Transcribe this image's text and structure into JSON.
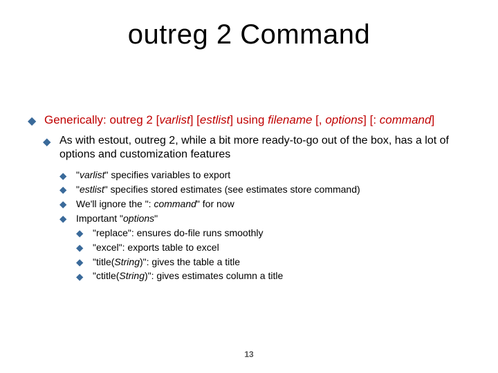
{
  "title": "outreg 2 Command",
  "generic": {
    "prefix": "Generically: outreg 2 [",
    "varlist": "varlist",
    "mid1": "] [",
    "estlist": "estlist",
    "mid2": "] using ",
    "filename": "filename",
    "mid3": " [, ",
    "options": "options",
    "mid4": "] [: ",
    "command": "command",
    "end": "]"
  },
  "lvl2_text": "As with estout, outreg 2, while a bit more ready-to-go out of the box, has a lot of options and customization features",
  "l3a": {
    "q1": "\"",
    "v": "varlist",
    "rest": "\" specifies variables to export"
  },
  "l3b": {
    "q1": "\"",
    "v": "estlist",
    "rest": "\" specifies stored estimates (see estimates store command)"
  },
  "l3c": {
    "pre": "We'll ignore the \": ",
    "cmd": "command",
    "post": "\" for now"
  },
  "l3d": {
    "pre": "Important \"",
    "opt": "options",
    "post": "\""
  },
  "l4a": "\"replace\": ensures do-file runs smoothly",
  "l4b": "\"excel\": exports table to excel",
  "l4c_pre": "\"title(",
  "l4c_str": "String",
  "l4c_post": ")\": gives the table a title",
  "l4d_pre": "\"ctitle(",
  "l4d_str": "String",
  "l4d_post": ")\": gives estimates column a title",
  "page_number": "13"
}
